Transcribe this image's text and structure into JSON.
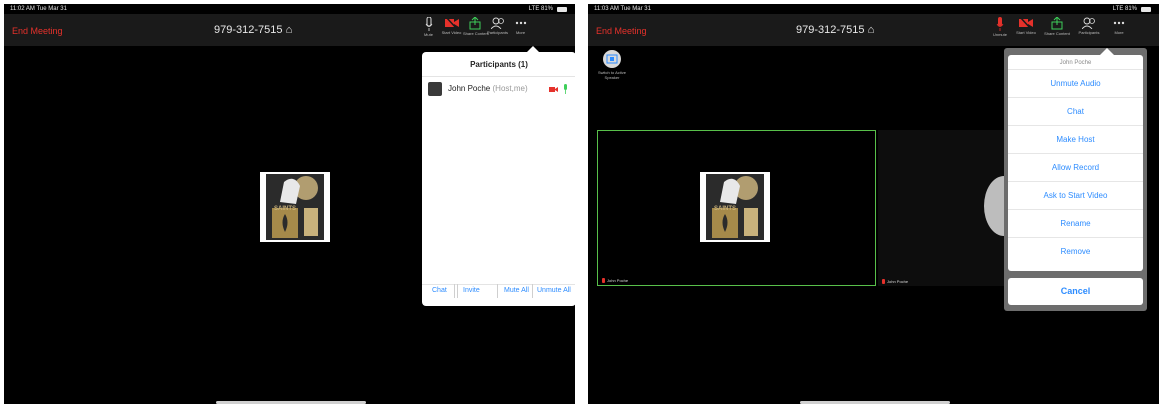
{
  "left": {
    "status": {
      "time": "11:02 AM  Tue Mar 31",
      "signal": "LTE 81%"
    },
    "top_bar": {
      "end_meeting": "End Meeting",
      "meeting_id": "979-312-7515"
    },
    "toolbar": [
      {
        "icon": "mic-icon",
        "label": "Mute"
      },
      {
        "icon": "video-off-icon",
        "label": "Start Video"
      },
      {
        "icon": "share-icon",
        "label": "Share Content"
      },
      {
        "icon": "participants-icon",
        "label": "Participants"
      },
      {
        "icon": "more-icon",
        "label": "More"
      }
    ],
    "logo_text": "SAINTS",
    "panel": {
      "title": "Participants (1)",
      "participant_name": "John Poche",
      "participant_role": "(Host,me)",
      "footer": {
        "chat": "Chat",
        "invite": "Invite",
        "mute_all": "Mute All",
        "unmute_all": "Unmute All"
      }
    }
  },
  "right": {
    "status": {
      "time": "11:03 AM  Tue Mar 31",
      "signal": "LTE 81%"
    },
    "top_bar": {
      "end_meeting": "End Meeting",
      "meeting_id": "979-312-7515"
    },
    "toolbar": [
      {
        "icon": "mic-muted-icon",
        "label": "Unmute"
      },
      {
        "icon": "video-off-icon",
        "label": "Start Video"
      },
      {
        "icon": "share-icon",
        "label": "Share Content"
      },
      {
        "icon": "participants-icon",
        "label": "Participants"
      },
      {
        "icon": "more-icon",
        "label": "More"
      }
    ],
    "switch_label": "Switch to Active Speaker",
    "logo_text": "SAINTS",
    "tiles": [
      {
        "name": "John Poche"
      },
      {
        "name": "John Poche"
      }
    ],
    "sheet": {
      "header": "John Poche",
      "items": [
        "Unmute Audio",
        "Chat",
        "Make Host",
        "Allow Record",
        "Ask to Start Video",
        "Rename",
        "Remove"
      ],
      "cancel": "Cancel"
    }
  },
  "colors": {
    "end_meeting": "#e5312b",
    "accent": "#2d8cff",
    "share_green": "#3ecf5a",
    "video_red": "#e5312b"
  }
}
